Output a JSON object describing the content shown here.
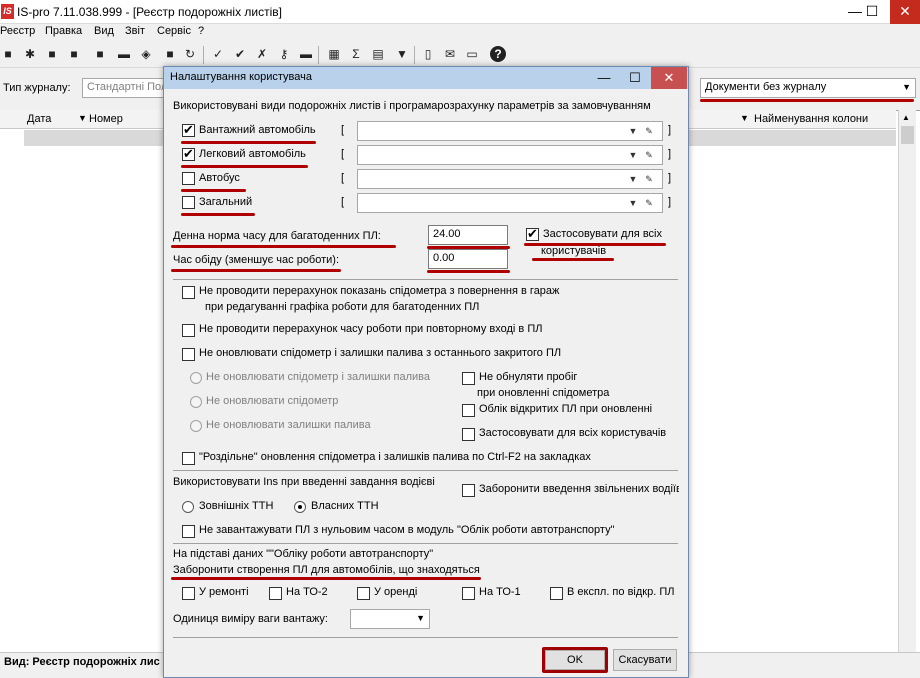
{
  "window": {
    "title": "IS-pro 7.11.038.999 - [Реєстр подорожніх листів]",
    "logo": "IS",
    "minimize": "—",
    "maximize": "☐",
    "close": "✕"
  },
  "menu": [
    "Реєстр",
    "Правка",
    "Вид",
    "Звіт",
    "Сервіс",
    "?"
  ],
  "filter": {
    "label": "Тип журналу:",
    "value": "Стандартні Пол",
    "journal": "Документи без журналу"
  },
  "grid": {
    "columns": [
      "Дата",
      "Номер",
      "Найменування колони"
    ]
  },
  "status": {
    "text": "Вид: Реєстр подорожніх лис"
  },
  "dialog": {
    "title": "Налаштування користувача",
    "close": "✕",
    "intro": "Використовувані види подорожніх листів і програмарозрахунку параметрів за замовчуванням",
    "vehicle_types": [
      {
        "label": "Вантажний автомобіль",
        "checked": true
      },
      {
        "label": "Легковий автомобіль",
        "checked": true
      },
      {
        "label": "Автобус",
        "checked": false
      },
      {
        "label": "Загальний",
        "checked": false
      }
    ],
    "bracket_open": "[",
    "bracket_close": "]",
    "daily_norm_label": "Денна норма часу для багатоденних ПЛ:",
    "daily_norm_value": "24.00",
    "apply_all_label_1": "Застосовувати для всіх",
    "apply_all_label_2": "користувачів",
    "lunch_label": "Час обіду  (зменшує час роботи):",
    "lunch_value": "0.00",
    "opt1_line1": "Не проводити перерахунок показань спідометра з повернення в гараж",
    "opt1_line2": "при редагуванні графіка роботи для багатоденних ПЛ",
    "opt2": "Не проводити перерахунок часу роботи при повторному вході в ПЛ",
    "opt3": "Не оновлювати спідометр і залишки палива з останнього закритого ПЛ",
    "radio_a": "Не оновлювати спідометр і залишки палива",
    "radio_b": "Не оновлювати спідометр",
    "radio_c": "Не оновлювати залишки палива",
    "chk_mileage_1": "Не обнуляти пробіг",
    "chk_mileage_2": "при оновленні спідометра",
    "chk_open_pl": "Облік відкритих ПЛ при оновленні",
    "chk_apply_all": "Застосовувати для всіх користувачів",
    "separate_update": "\"Роздільне\" оновлення спідометра і залишків палива по Ctrl-F2 на закладках",
    "ins_label": "Використовувати Ins при введенні завдання водієві",
    "radio_external": "Зовнішніх ТТН",
    "radio_own": "Власних ТТН",
    "forbid_fired": "Заборонити введення звільнених водіїв",
    "zero_time": "Не завантажувати ПЛ з нульовим часом в модуль \"Облік роботи автотранспорту\"",
    "based_on": "На підставі даних \"\"Обліку роботи автотранспорту\"",
    "forbid_create": "Заборонити створення ПЛ для автомобілів, що знаходяться",
    "status_checks": [
      "У ремонті",
      "На ТО-2",
      "У оренді",
      "На ТО-1",
      "В експл. по відкр. ПЛ"
    ],
    "weight_unit_label": "Одиниця виміру ваги вантажу:",
    "ok": "OK",
    "cancel": "Скасувати"
  }
}
